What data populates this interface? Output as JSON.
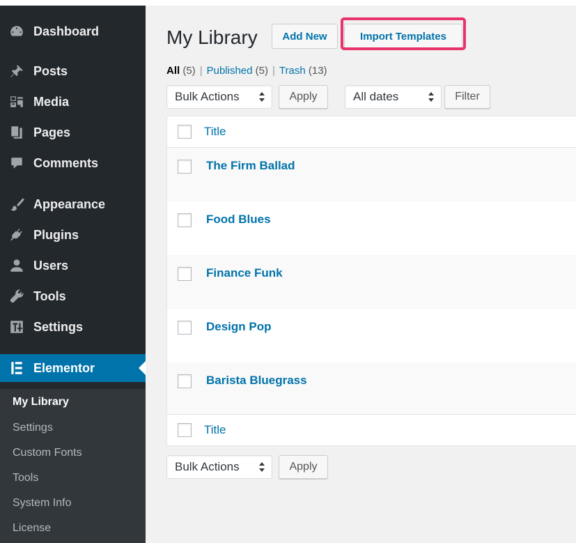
{
  "sidebar": {
    "items": [
      {
        "label": "Dashboard",
        "icon": "dashboard-icon"
      },
      {
        "label": "Posts",
        "icon": "pin-icon"
      },
      {
        "label": "Media",
        "icon": "media-icon"
      },
      {
        "label": "Pages",
        "icon": "pages-icon"
      },
      {
        "label": "Comments",
        "icon": "comment-icon"
      },
      {
        "label": "Appearance",
        "icon": "brush-icon"
      },
      {
        "label": "Plugins",
        "icon": "plug-icon"
      },
      {
        "label": "Users",
        "icon": "user-icon"
      },
      {
        "label": "Tools",
        "icon": "wrench-icon"
      },
      {
        "label": "Settings",
        "icon": "settings-icon"
      },
      {
        "label": "Elementor",
        "icon": "elementor-icon"
      }
    ],
    "submenu": [
      "My Library",
      "Settings",
      "Custom Fonts",
      "Tools",
      "System Info",
      "License"
    ]
  },
  "header": {
    "title": "My Library",
    "add_new": "Add New",
    "import_templates": "Import Templates"
  },
  "filters": {
    "all": "All",
    "all_count": "(5)",
    "published": "Published",
    "published_count": "(5)",
    "trash": "Trash",
    "trash_count": "(13)",
    "separator": "|"
  },
  "toolbar": {
    "bulk_actions": "Bulk Actions",
    "apply": "Apply",
    "dates": "All dates",
    "filter": "Filter"
  },
  "table": {
    "column_title": "Title",
    "rows": [
      "The Firm Ballad",
      "Food Blues",
      "Finance Funk",
      "Design Pop",
      "Barista Bluegrass"
    ]
  },
  "colors": {
    "sidebar_bg": "#23282d",
    "active_bg": "#0073aa",
    "link": "#0073aa",
    "highlight": "#e8336b"
  }
}
